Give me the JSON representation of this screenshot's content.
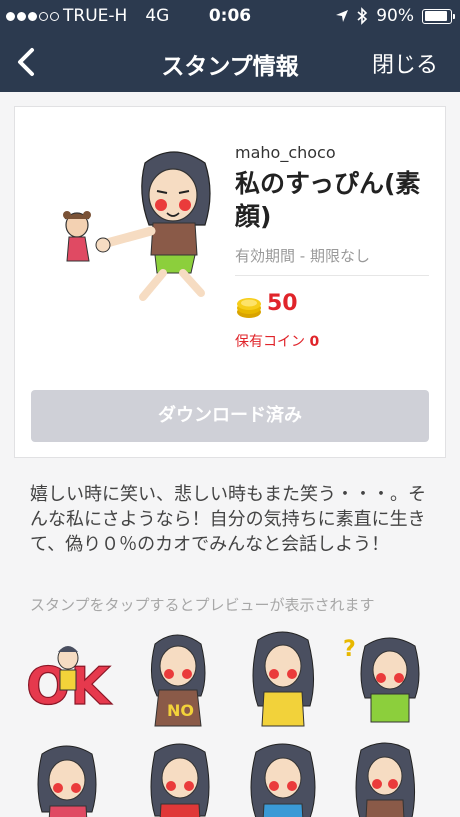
{
  "statusbar": {
    "carrier": "TRUE-H",
    "network": "4G",
    "time": "0:06",
    "battery": "90%",
    "battery_level": 0.9,
    "signal_dots": 2,
    "signal_total": 5
  },
  "nav": {
    "title": "スタンプ情報",
    "close_label": "閉じる",
    "back_icon": "chevron-left-icon"
  },
  "sticker": {
    "author": "maho_choco",
    "title": "私のすっぴん(素顔)",
    "validity": "有効期間 - 期限なし",
    "price": "50",
    "owned_label": "保有コイン",
    "owned_count": "0",
    "download_label": "ダウンロード済み"
  },
  "description": "嬉しい時に笑い、悲しい時もまた笑う・・・。そんな私にさようなら！自分の気持ちに素直に生きて、偽り０％のカオでみんなと会話しよう！",
  "hint": "スタンプをタップするとプレビューが表示されます",
  "preview_stickers": [
    {
      "text": "OK"
    },
    {
      "text": "NO"
    },
    {
      "text": ""
    },
    {
      "text": "?"
    },
    {
      "text": ""
    },
    {
      "text": ""
    },
    {
      "text": ""
    },
    {
      "text": ""
    }
  ],
  "colors": {
    "nav_bg": "#2c3a4f",
    "price": "#e0242a",
    "button_disabled": "#cfd0d7"
  }
}
